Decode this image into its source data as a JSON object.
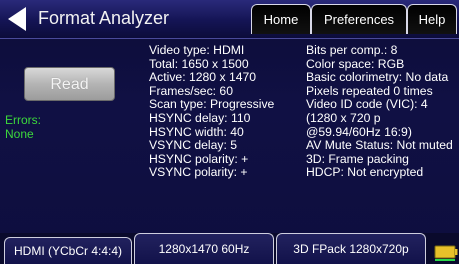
{
  "header": {
    "title": "Format Analyzer",
    "tabs": [
      {
        "label": "Home"
      },
      {
        "label": "Preferences"
      },
      {
        "label": "Help"
      }
    ]
  },
  "left_panel": {
    "read_button_label": "Read",
    "errors_label": "Errors:",
    "errors_value": "None"
  },
  "details": {
    "left": [
      "Video type: HDMI",
      "Total: 1650 x 1500",
      "Active: 1280 x 1470",
      "Frames/sec: 60",
      "Scan type: Progressive",
      "HSYNC delay: 110",
      "HSYNC width: 40",
      "VSYNC delay: 5",
      "HSYNC polarity: +",
      "VSYNC polarity: +"
    ],
    "right": [
      "Bits per comp.: 8",
      "Color space: RGB",
      "Basic colorimetry: No data",
      "Pixels repeated 0 times",
      "Video ID code (VIC): 4",
      "(1280 x 720 p",
      "@59.94/60Hz 16:9)",
      "AV Mute Status: Not muted",
      "3D: Frame packing",
      "HDCP: Not encrypted"
    ]
  },
  "status_bar": {
    "items": [
      "HDMI (YCbCr 4:4:4)",
      "1280x1470 60Hz",
      "3D FPack 1280x720p"
    ],
    "battery_icon": "battery-icon"
  },
  "colors": {
    "background": "#101044",
    "errors_text": "#3cd83c",
    "battery": "#e8c12a"
  }
}
